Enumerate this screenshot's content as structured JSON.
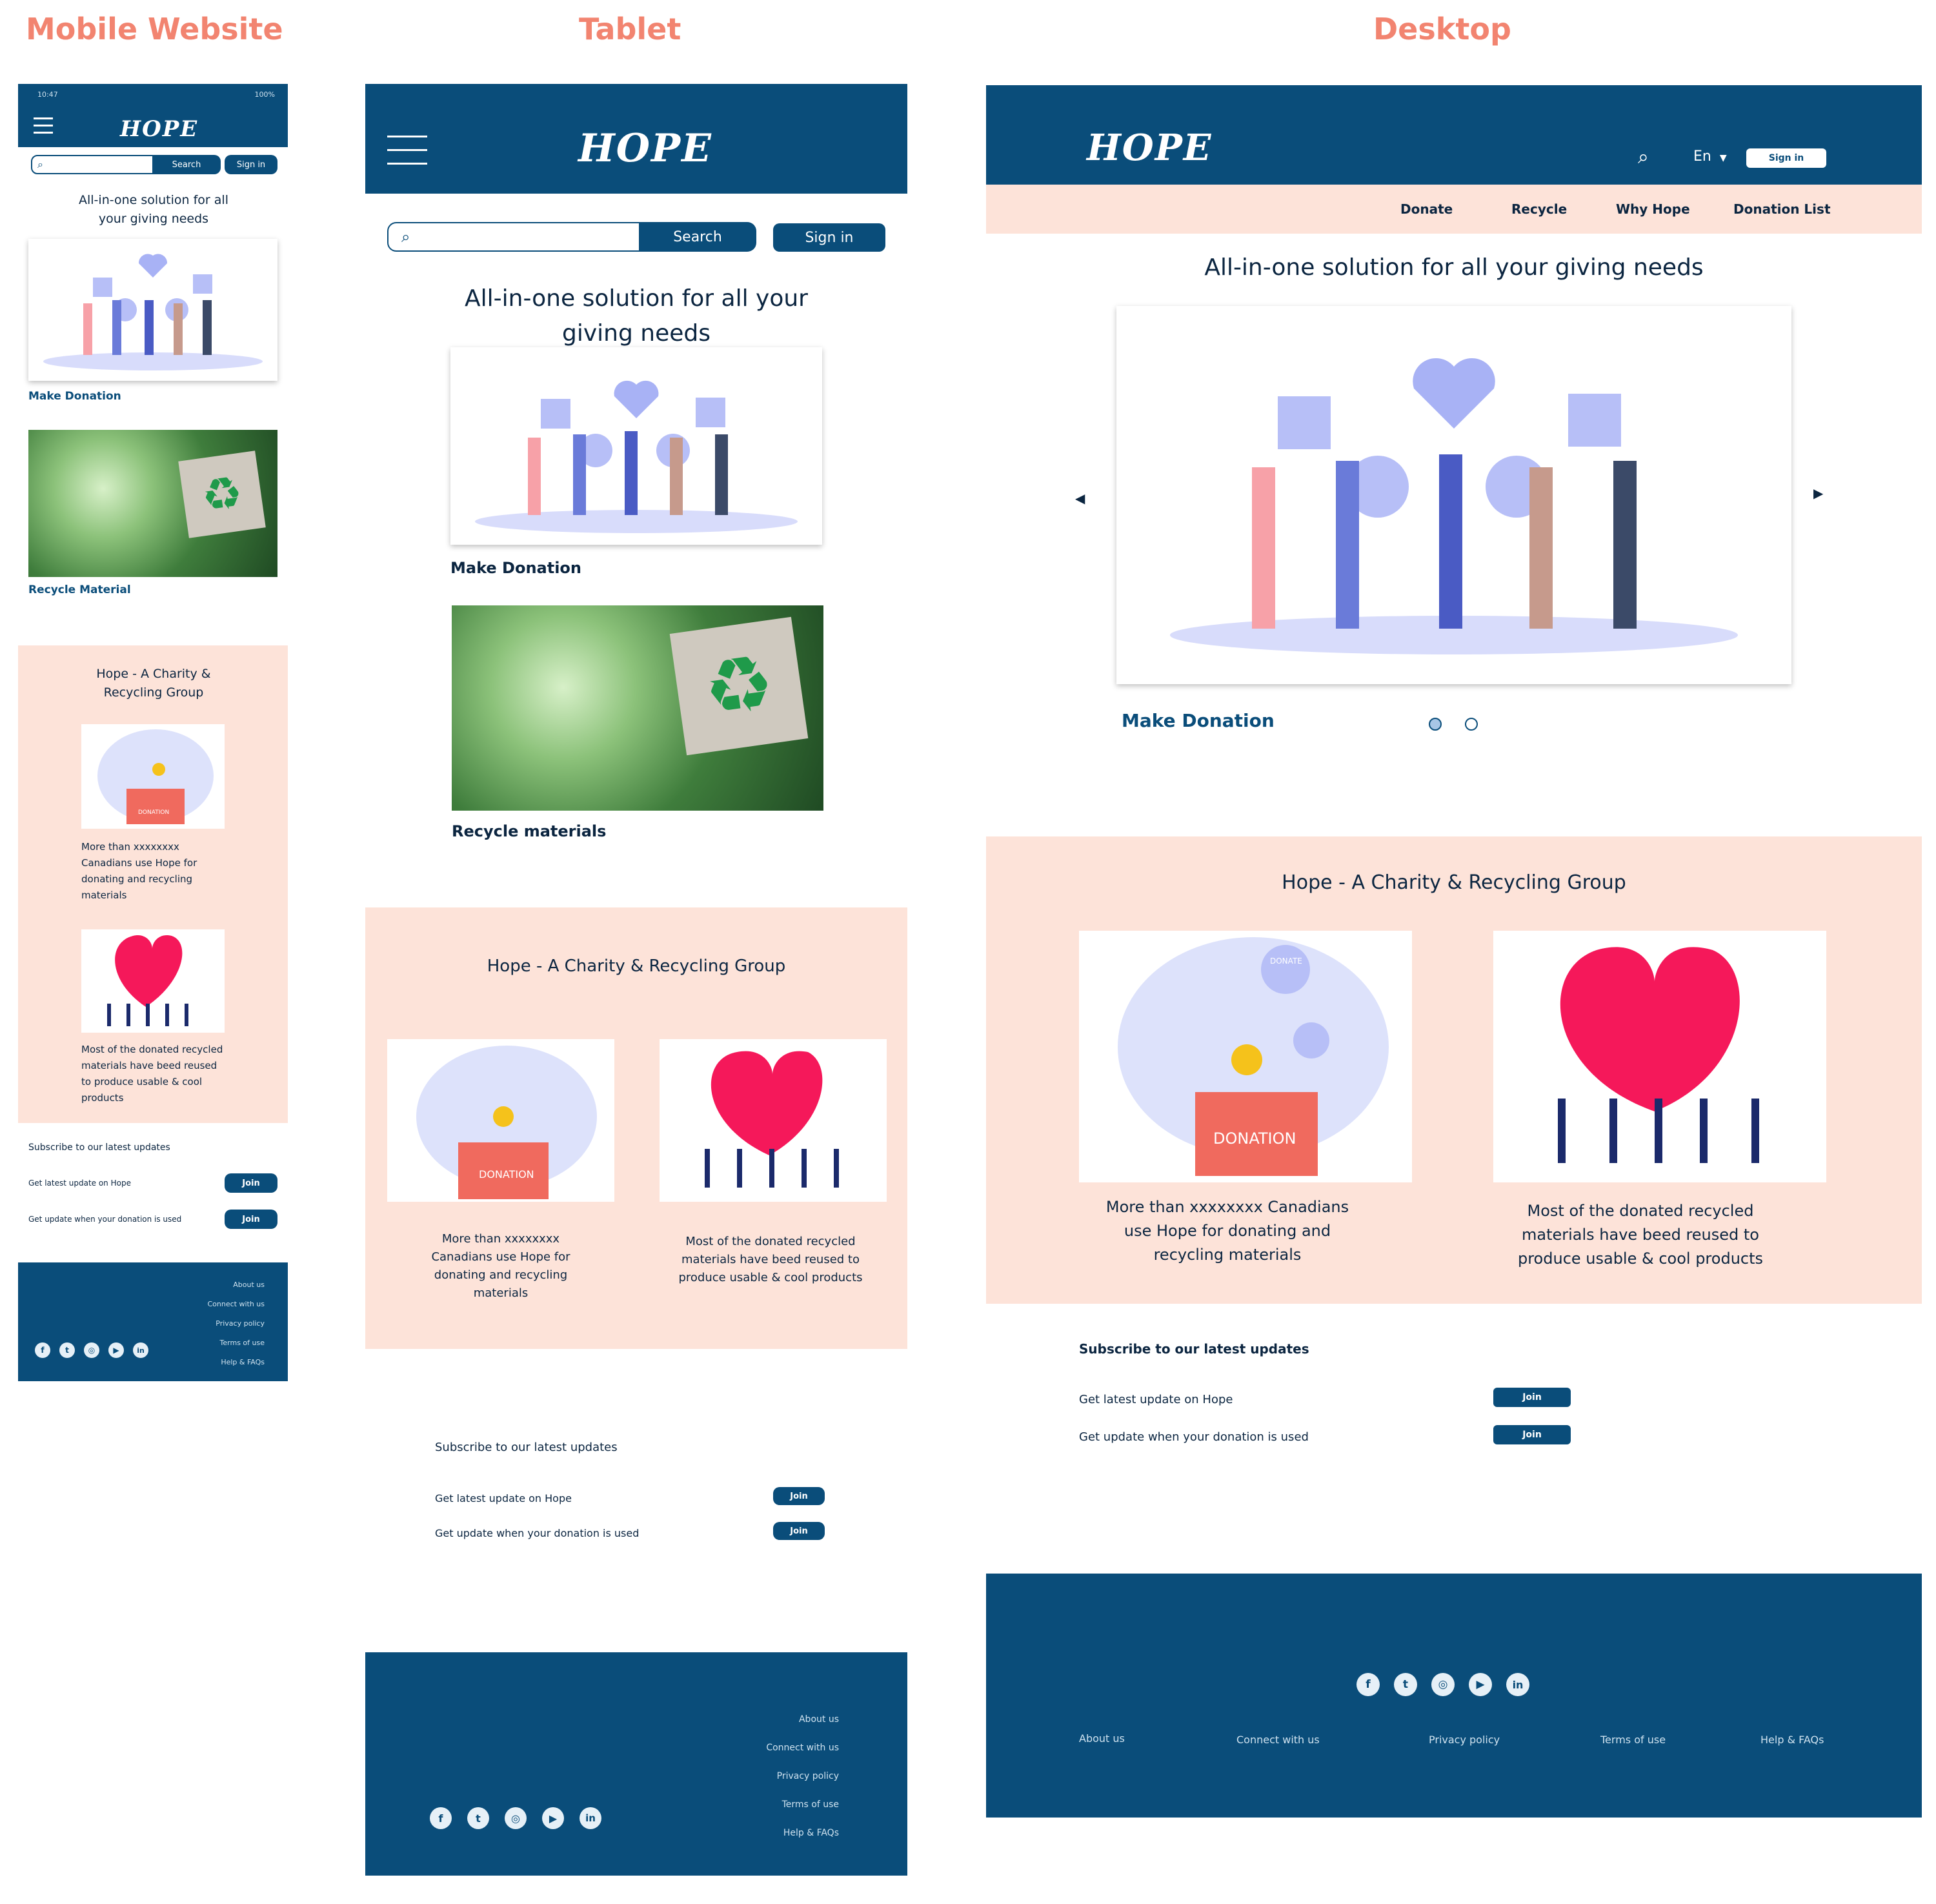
{
  "headings": {
    "mobile": "Mobile Website",
    "tablet": "Tablet",
    "desktop": "Desktop"
  },
  "brand": {
    "logo_text": "HOPE",
    "logo_o": "O"
  },
  "status_bar": {
    "time": "10:47",
    "battery": "100%"
  },
  "search": {
    "button": "Search",
    "placeholder": ""
  },
  "sign_in": "Sign in",
  "lang": {
    "current": "En"
  },
  "nav": [
    "Donate",
    "Recycle",
    "Why Hope",
    "Donation List"
  ],
  "hero": {
    "mobile_title": "All-in-one solution for all your giving needs",
    "tablet_title": "All-in-one solution for all your giving needs",
    "desktop_title": "All-in-one solution for all your giving needs"
  },
  "cards": {
    "make_donation": "Make Donation",
    "recycle_material": "Recycle Material",
    "recycle_materials": "Recycle materials"
  },
  "about": {
    "title": "Hope - A Charity & Recycling Group",
    "stat1": "More than xxxxxxxx Canadians use Hope for donating and recycling materials",
    "stat2": "Most of the donated recycled materials have beed reused to produce usable & cool products",
    "donation_box_label": "DONATION",
    "donate_badge": "DONATE"
  },
  "subscribe": {
    "title": "Subscribe to our latest updates",
    "rows": [
      {
        "label": "Get latest update on Hope",
        "button": "Join"
      },
      {
        "label": "Get update when your donation is used",
        "button": "Join"
      }
    ]
  },
  "footer": {
    "links": [
      "About us",
      "Connect with us",
      "Privacy policy",
      "Terms of use",
      "Help & FAQs"
    ],
    "social": [
      "facebook-icon",
      "twitter-icon",
      "instagram-icon",
      "youtube-icon",
      "linkedin-icon"
    ]
  },
  "colors": {
    "navy": "#0a4d7a",
    "peach": "#fde3d9",
    "heading": "#f28470",
    "accent_yellow": "#f5c21b",
    "heart": "#f5185a",
    "lavender": "#a8b2f5"
  }
}
